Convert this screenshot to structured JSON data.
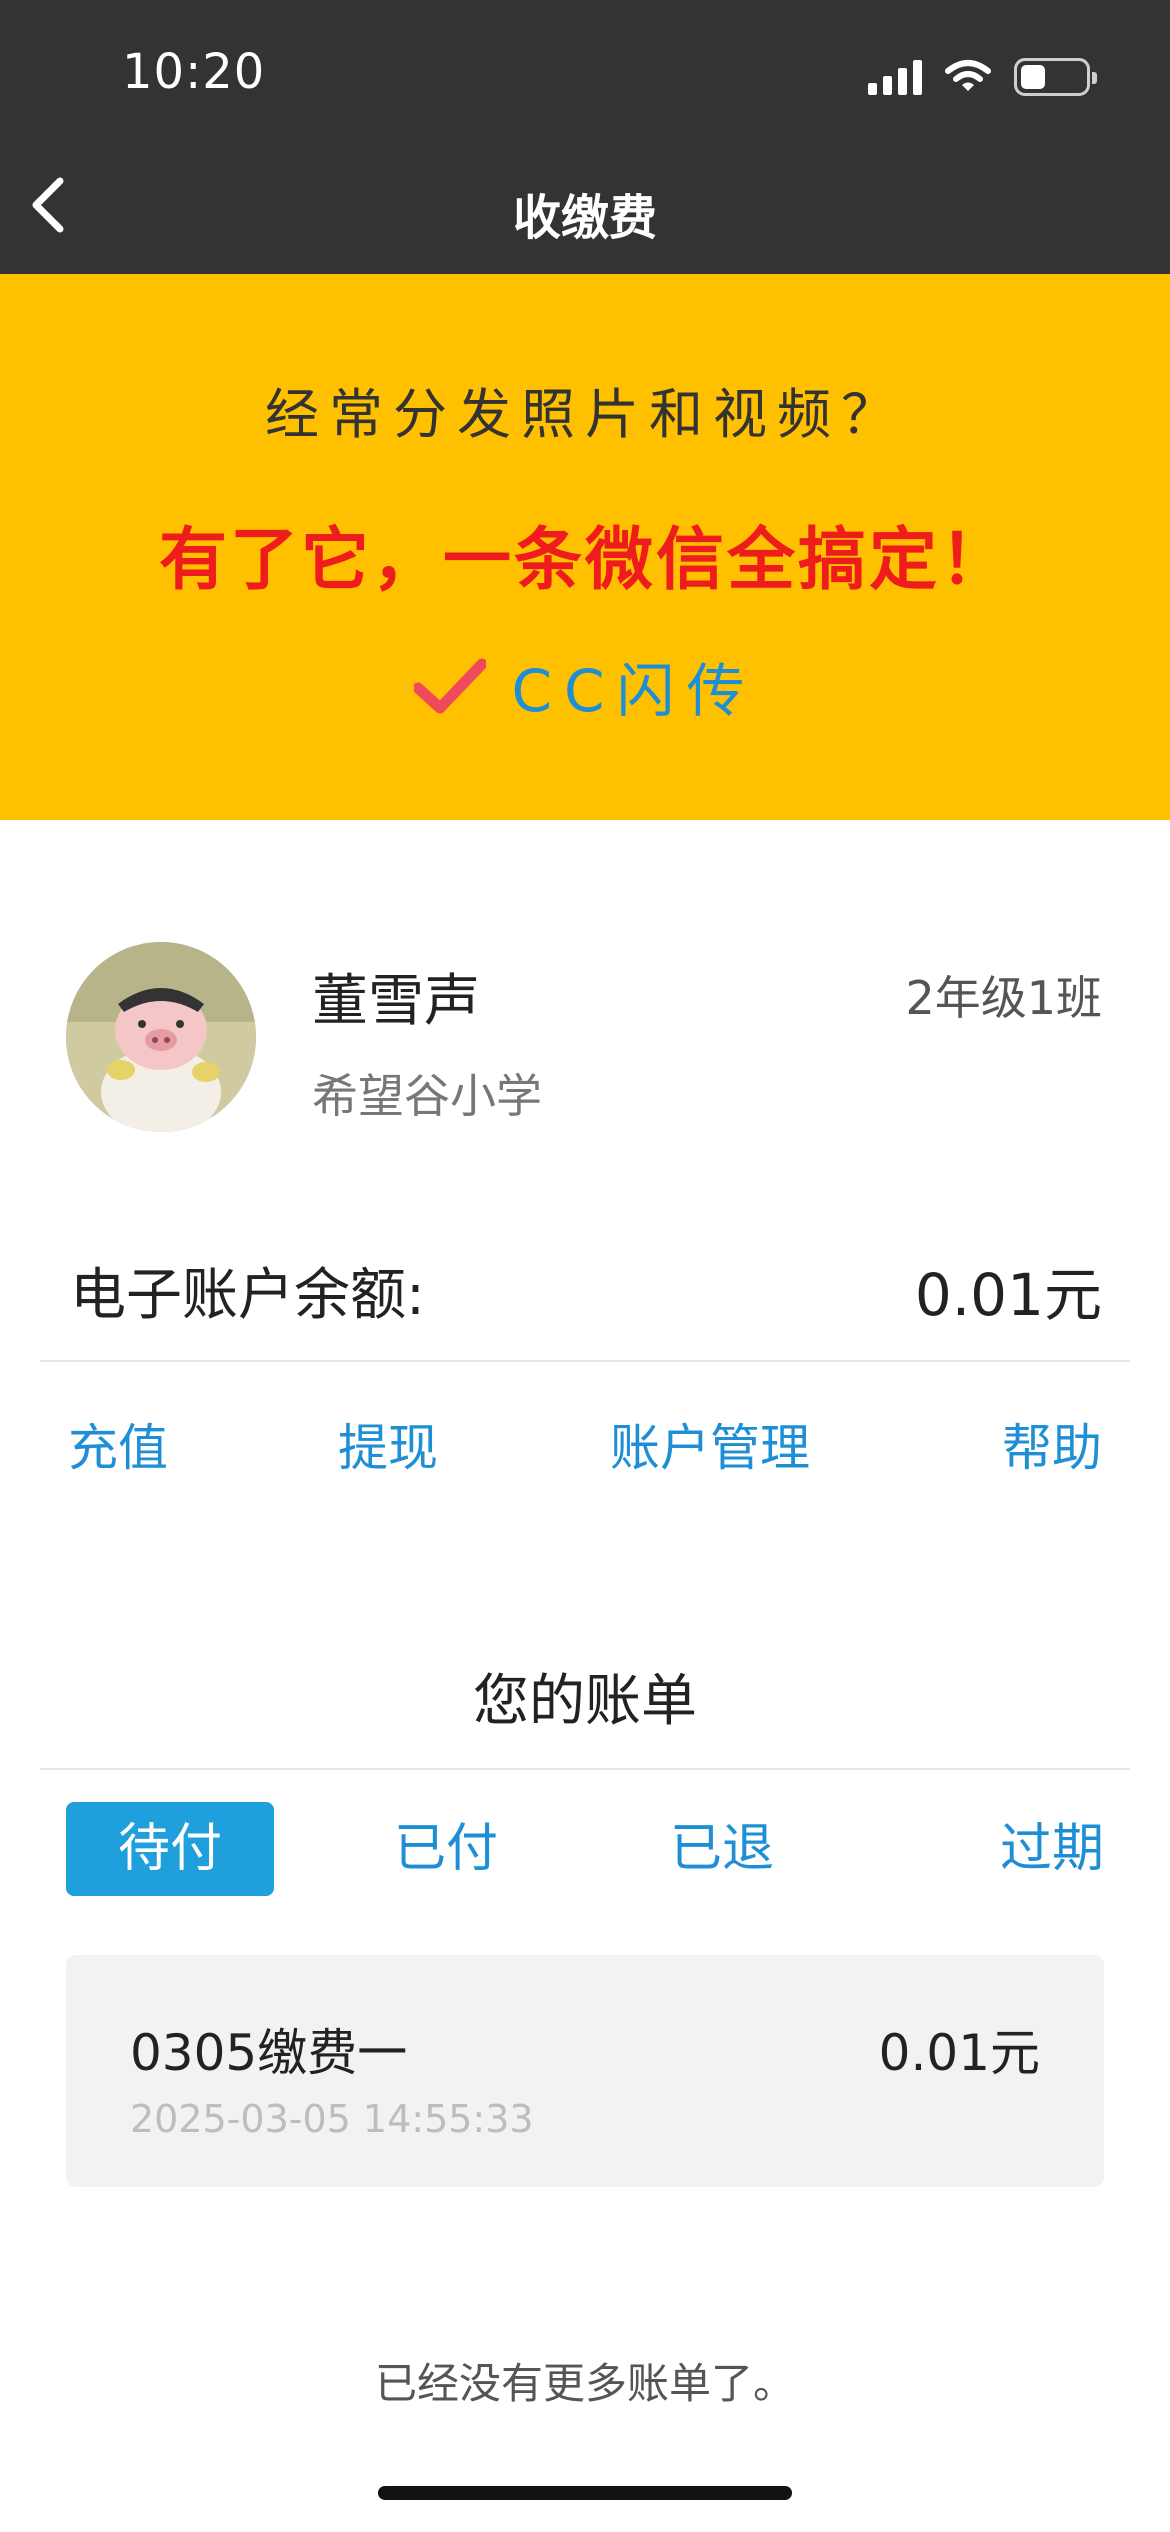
{
  "status_bar": {
    "time": "10:20"
  },
  "nav": {
    "title": "收缴费"
  },
  "banner": {
    "line1": "经常分发照片和视频？",
    "line2": "有了它，一条微信全搞定！",
    "brand": "CC闪传",
    "colors": {
      "background": "#ffc000",
      "headline": "#ee1c1c",
      "brand": "#1f8fd5",
      "check": "#ef4a5c"
    }
  },
  "profile": {
    "name": "董雪声",
    "school": "希望谷小学",
    "class": "2年级1班"
  },
  "account": {
    "balance_label": "电子账户余额:",
    "balance_value": "0.01元"
  },
  "actions": {
    "recharge": "充值",
    "withdraw": "提现",
    "manage": "账户管理",
    "help": "帮助"
  },
  "bills": {
    "title": "您的账单",
    "tabs": [
      "待付",
      "已付",
      "已退",
      "过期"
    ],
    "active_tab": "待付",
    "items": [
      {
        "name": "0305缴费一",
        "amount": "0.01元",
        "date": "2025-03-05 14:55:33"
      }
    ],
    "no_more": "已经没有更多账单了。"
  },
  "accent_color": "#1f8fd5"
}
